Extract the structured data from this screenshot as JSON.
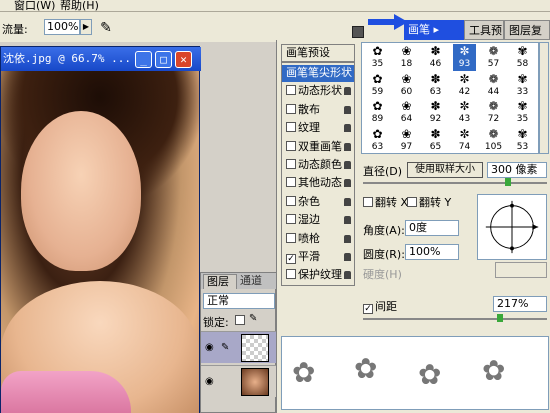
{
  "menubar": {
    "items": [
      "窗口(W)",
      "帮助(H)"
    ]
  },
  "options": {
    "flow_label": "流量:",
    "flow_value": "100%",
    "airbrush_icon": "airbrush-icon"
  },
  "dock": {
    "tabs": [
      "画笔",
      "工具预设",
      "图层复合"
    ]
  },
  "image_window": {
    "title": "沈依.jpg @ 66.7% ..."
  },
  "layers": {
    "tabs": [
      "图层",
      "通道"
    ],
    "blend_mode": "正常",
    "lock_label": "锁定:"
  },
  "brushes": {
    "presets_label": "画笔预设",
    "items": [
      {
        "label": "画笔笔尖形状",
        "checkbox": false,
        "checked": false,
        "lock": false,
        "selected": true
      },
      {
        "label": "动态形状",
        "checkbox": true,
        "checked": false,
        "lock": true
      },
      {
        "label": "散布",
        "checkbox": true,
        "checked": false,
        "lock": true
      },
      {
        "label": "纹理",
        "checkbox": true,
        "checked": false,
        "lock": true
      },
      {
        "label": "双重画笔",
        "checkbox": true,
        "checked": false,
        "lock": true
      },
      {
        "label": "动态颜色",
        "checkbox": true,
        "checked": false,
        "lock": true
      },
      {
        "label": "其他动态",
        "checkbox": true,
        "checked": false,
        "lock": true
      },
      {
        "label": "杂色",
        "checkbox": true,
        "checked": false,
        "lock": true
      },
      {
        "label": "湿边",
        "checkbox": true,
        "checked": false,
        "lock": true
      },
      {
        "label": "喷枪",
        "checkbox": true,
        "checked": false,
        "lock": true
      },
      {
        "label": "平滑",
        "checkbox": true,
        "checked": true,
        "lock": true
      },
      {
        "label": "保护纹理",
        "checkbox": true,
        "checked": false,
        "lock": true
      }
    ],
    "tips": [
      "35",
      "18",
      "46",
      "93",
      "57",
      "58",
      "59",
      "60",
      "63",
      "42",
      "44",
      "33",
      "89",
      "64",
      "92",
      "43",
      "72",
      "35",
      "63",
      "97",
      "65",
      "74",
      "105",
      "53"
    ],
    "selected_tip_index": 3,
    "diameter_label": "直径(D)",
    "use_sample_label": "使用取样大小",
    "diameter_value": "300 像素",
    "flip_x_label": "翻转 X",
    "flip_y_label": "翻转 Y",
    "angle_label": "角度(A):",
    "angle_value": "0度",
    "roundness_label": "圆度(R):",
    "roundness_value": "100%",
    "hardness_label": "硬度(H)",
    "spacing_label": "间距",
    "spacing_checked": true,
    "spacing_value": "217%"
  },
  "colors": {
    "accent": "#316ac5",
    "title_blue": "#1748c8"
  }
}
